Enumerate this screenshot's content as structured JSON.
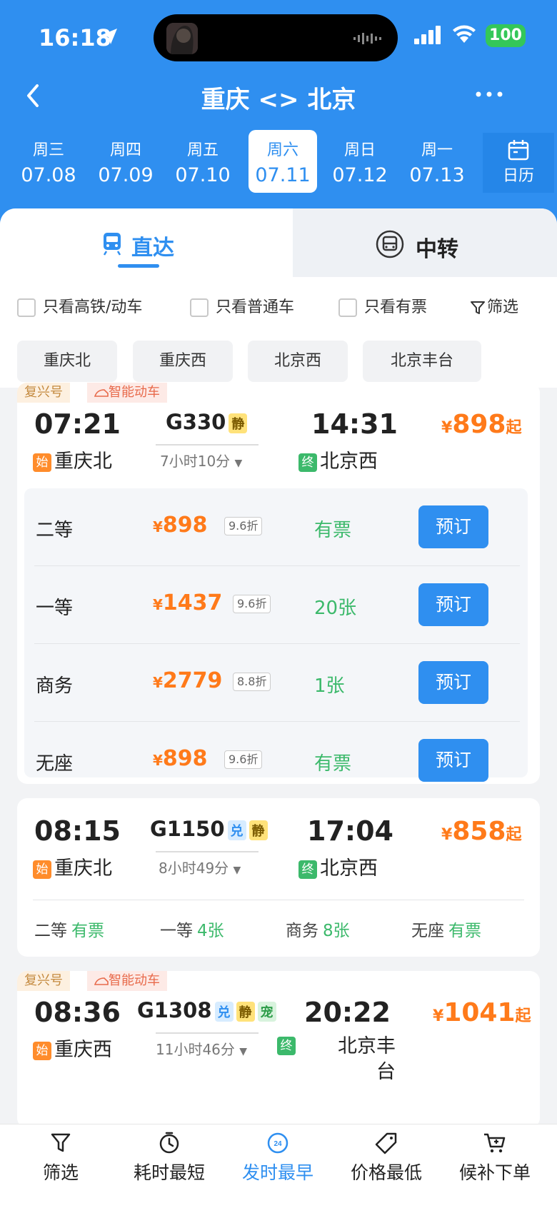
{
  "status": {
    "time": "16:18",
    "battery": "100"
  },
  "nav": {
    "title": "重庆 <> 北京"
  },
  "dates": [
    {
      "week": "周三",
      "date": "07.08"
    },
    {
      "week": "周四",
      "date": "07.09"
    },
    {
      "week": "周五",
      "date": "07.10"
    },
    {
      "week": "周六",
      "date": "07.11"
    },
    {
      "week": "周日",
      "date": "07.12"
    },
    {
      "week": "周一",
      "date": "07.13"
    }
  ],
  "calendar_label": "日历",
  "tabs": {
    "direct": "直达",
    "transfer": "中转"
  },
  "filters": {
    "gaotie": "只看高铁/动车",
    "putong": "只看普通车",
    "youpiao": "只看有票",
    "shaixuan": "筛选"
  },
  "stations": [
    "重庆北",
    "重庆西",
    "北京西",
    "北京丰台"
  ],
  "trains": [
    {
      "tags": [
        "复兴号",
        "智能动车"
      ],
      "dep_time": "07:21",
      "train_no": "G330",
      "badges": [
        "静"
      ],
      "arr_time": "14:31",
      "duration": "7小时10分",
      "dep_station": "重庆北",
      "arr_station": "北京西",
      "start_mark": "始",
      "end_mark": "终",
      "price": "898",
      "yen": "¥",
      "qi": "起",
      "seats": [
        {
          "name": "二等",
          "price": "898",
          "discount": "9.6折",
          "avail": "有票",
          "action": "预订"
        },
        {
          "name": "一等",
          "price": "1437",
          "discount": "9.6折",
          "avail": "20张",
          "action": "预订"
        },
        {
          "name": "商务",
          "price": "2779",
          "discount": "8.8折",
          "avail": "1张",
          "action": "预订"
        },
        {
          "name": "无座",
          "price": "898",
          "discount": "9.6折",
          "avail": "有票",
          "action": "预订"
        }
      ]
    },
    {
      "dep_time": "08:15",
      "train_no": "G1150",
      "badges": [
        "兑",
        "静"
      ],
      "arr_time": "17:04",
      "duration": "8小时49分",
      "dep_station": "重庆北",
      "arr_station": "北京西",
      "start_mark": "始",
      "end_mark": "终",
      "price": "858",
      "yen": "¥",
      "qi": "起",
      "seat_summary": [
        {
          "name": "二等",
          "value": "有票"
        },
        {
          "name": "一等",
          "value": "4张"
        },
        {
          "name": "商务",
          "value": "8张"
        },
        {
          "name": "无座",
          "value": "有票"
        }
      ]
    },
    {
      "tags": [
        "复兴号",
        "智能动车"
      ],
      "dep_time": "08:36",
      "train_no": "G1308",
      "badges": [
        "兑",
        "静",
        "宠"
      ],
      "arr_time": "20:22",
      "duration": "11小时46分",
      "dep_station": "重庆西",
      "arr_station_line1": "北京丰",
      "arr_station_line2": "台",
      "start_mark": "始",
      "end_mark": "终",
      "price": "1041",
      "yen": "¥",
      "qi": "起"
    }
  ],
  "bottom_bar": [
    {
      "label": "筛选",
      "icon": "filter-icon"
    },
    {
      "label": "耗时最短",
      "icon": "clock-icon"
    },
    {
      "label": "发时最早",
      "icon": "24h-icon",
      "active": true
    },
    {
      "label": "价格最低",
      "icon": "price-tag-icon"
    },
    {
      "label": "候补下单",
      "icon": "cart-icon"
    }
  ],
  "colors": {
    "primary": "#2f8ff0",
    "price": "#ff7a1a",
    "available": "#3cb96b"
  }
}
